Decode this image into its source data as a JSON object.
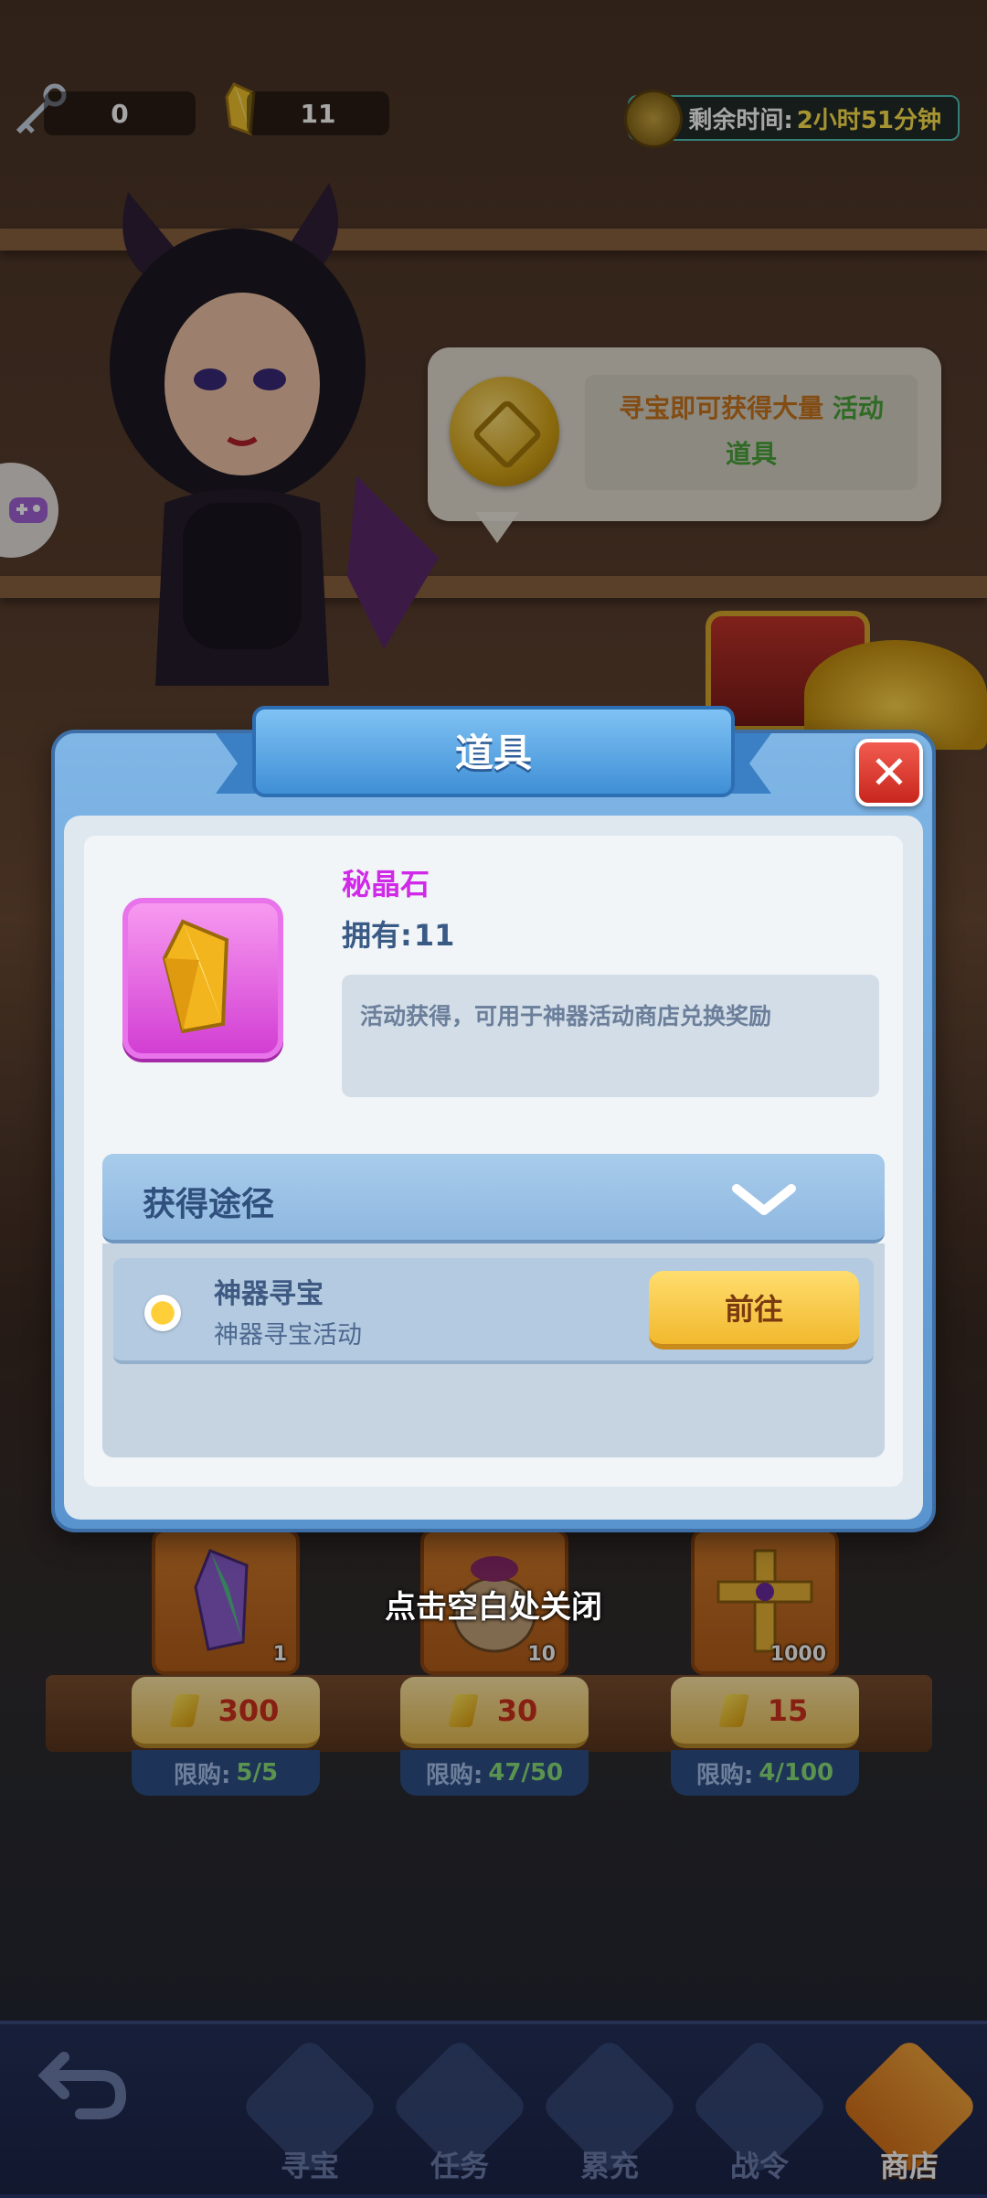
{
  "top_bar": {
    "keys_count": "0",
    "gems_count": "11",
    "timer_label": "剩余时间:",
    "timer_value": "2小时51分钟"
  },
  "bubble": {
    "text_part1": "寻宝即可获得大量",
    "text_highlight": "活动",
    "text_part2": "道具"
  },
  "modal": {
    "title": "道具",
    "close_symbol": "✕",
    "item_name": "秘晶石",
    "owned_label": "拥有:",
    "owned_value": "11",
    "description": "活动获得，可用于神器活动商店兑换奖励",
    "acquire_title": "获得途径",
    "routes": [
      {
        "title": "神器寻宝",
        "subtitle": "神器寻宝活动",
        "button": "前往"
      }
    ]
  },
  "close_hint": "点击空白处关闭",
  "shop": {
    "items": [
      {
        "icon": "crystal-icon",
        "count": "1",
        "price": "300",
        "limit_label": "限购:",
        "limit_value": "5/5"
      },
      {
        "icon": "bag-icon",
        "count": "10",
        "price": "30",
        "limit_label": "限购:",
        "limit_value": "47/50"
      },
      {
        "icon": "cross-icon",
        "count": "1000",
        "price": "15",
        "limit_label": "限购:",
        "limit_value": "4/100"
      }
    ]
  },
  "nav": {
    "items": [
      {
        "label": "寻宝",
        "icon": "key-icon"
      },
      {
        "label": "任务",
        "icon": "task-icon"
      },
      {
        "label": "累充",
        "icon": "money-bag-icon"
      },
      {
        "label": "战令",
        "icon": "crown-icon"
      },
      {
        "label": "商店",
        "icon": "shop-icon",
        "active": true
      }
    ]
  },
  "colors": {
    "modal_blue": "#5a94cf",
    "item_purple": "#d129e8",
    "go_button": "#f1b92e",
    "price_red": "#d0301c",
    "limit_green": "#8be07b"
  }
}
